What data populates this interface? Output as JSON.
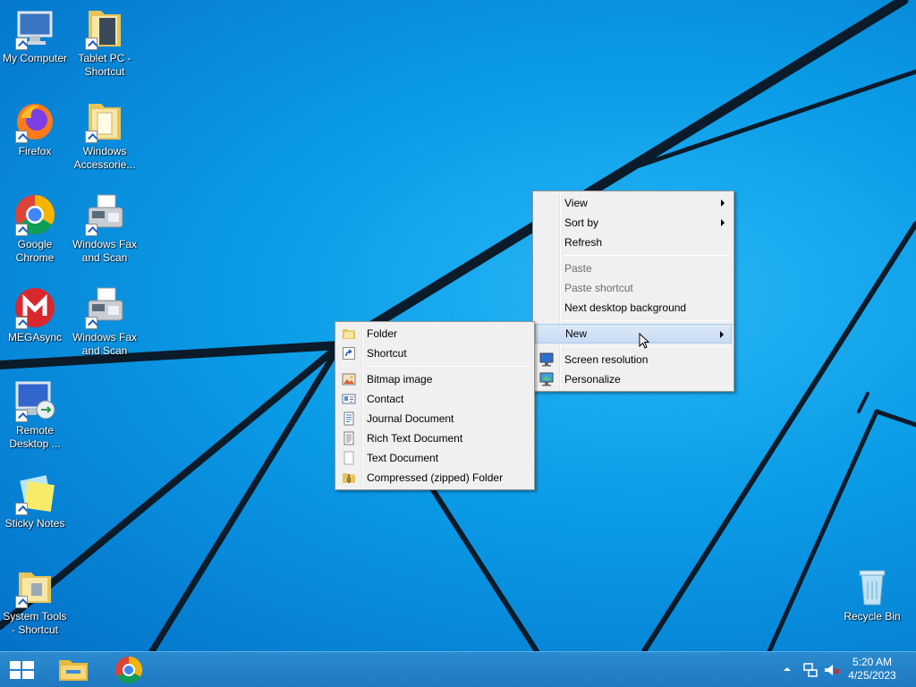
{
  "desktop": {
    "icons": [
      {
        "label": "My Computer"
      },
      {
        "label": "Tablet PC - Shortcut"
      },
      {
        "label": "Firefox"
      },
      {
        "label": "Windows Accessorie..."
      },
      {
        "label": "Google Chrome"
      },
      {
        "label": "Windows Fax and Scan"
      },
      {
        "label": "MEGAsync"
      },
      {
        "label": "Windows Fax and Scan"
      },
      {
        "label": "Remote Desktop ..."
      },
      {
        "label": "Sticky Notes"
      },
      {
        "label": "System Tools - Shortcut"
      },
      {
        "label": "Recycle Bin"
      }
    ]
  },
  "context_menu": {
    "view": "View",
    "sort_by": "Sort by",
    "refresh": "Refresh",
    "paste": "Paste",
    "paste_shortcut": "Paste shortcut",
    "next_background": "Next desktop background",
    "new": "New",
    "screen_resolution": "Screen resolution",
    "personalize": "Personalize"
  },
  "new_submenu": {
    "folder": "Folder",
    "shortcut": "Shortcut",
    "bitmap": "Bitmap image",
    "contact": "Contact",
    "journal": "Journal Document",
    "rich_text": "Rich Text Document",
    "text": "Text Document",
    "zip": "Compressed (zipped) Folder"
  },
  "taskbar": {
    "time": "5:20 AM",
    "date": "4/25/2023"
  },
  "colors": {
    "wallpaper": "#0a9ae6",
    "taskbar": "#1f79c0",
    "menu_bg": "#f0f0f0",
    "menu_hover": "#c8dcf3"
  }
}
